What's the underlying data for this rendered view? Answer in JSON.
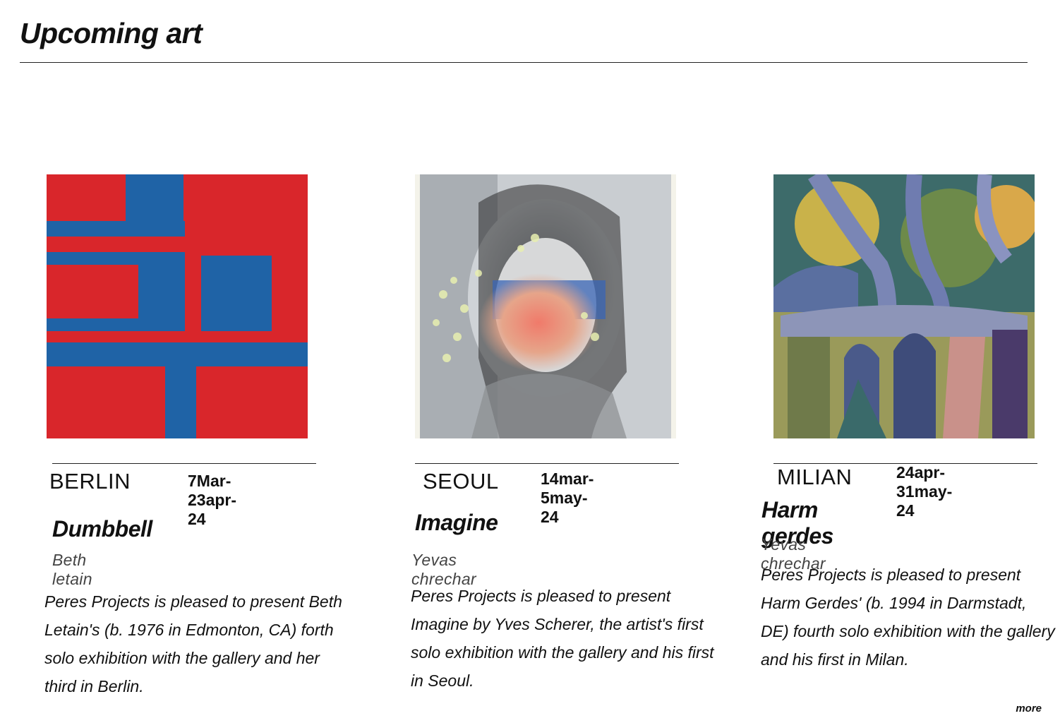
{
  "page": {
    "title": "Upcoming art",
    "more_label": "more"
  },
  "exhibitions": [
    {
      "city": "BERLIN",
      "dates": "7Mar-23apr-24",
      "title": "Dumbbell",
      "artist": "Beth letain",
      "description": "Peres Projects is pleased to present Beth Letain's  (b. 1976 in Edmonton, CA) forth solo exhibition with the gallery and her third in Berlin.",
      "artwork_colors": {
        "background": "#d9262b",
        "accent": "#1f63a6"
      }
    },
    {
      "city": "SEOUL",
      "dates": "14mar-5may-24",
      "title": "Imagine",
      "artist": "Yevas chrechar",
      "description": "Peres Projects is pleased to present Imagine by Yves Scherer, the artist's first solo exhibition with the gallery and his first in Seoul.",
      "artwork_colors": {
        "background": "#c9cdd1",
        "accent": "#3a65b5"
      }
    },
    {
      "city": "MILIAN",
      "dates": "24apr-31may-24",
      "title": "Harm gerdes",
      "artist": "Yevas chrechar",
      "description": "Peres Projects is pleased to present Harm Gerdes' (b. 1994 in Darmstadt, DE) fourth solo exhibition with the gallery and his first in Milan.",
      "artwork_colors": {
        "background": "#3e4a6b",
        "accent": "#c9b24a"
      }
    }
  ]
}
